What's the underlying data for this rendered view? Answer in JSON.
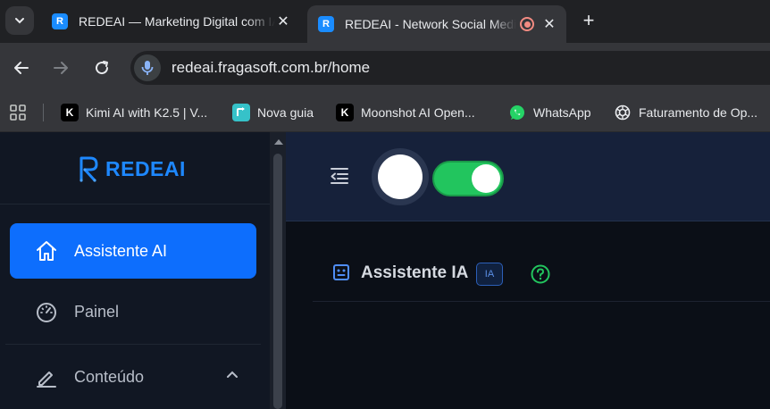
{
  "tabs": [
    {
      "title": "REDEAI — Marketing Digital com IA",
      "favicon": "R",
      "active": false
    },
    {
      "title": "REDEAI - Network Social Media",
      "favicon": "R",
      "active": true
    }
  ],
  "address": {
    "url": "redeai.fragasoft.com.br/home"
  },
  "bookmarks": [
    {
      "label": "Kimi AI with K2.5 | V...",
      "icon": "K"
    },
    {
      "label": "Nova guia",
      "icon": ""
    },
    {
      "label": "Moonshot AI Open...",
      "icon": "K"
    },
    {
      "label": "WhatsApp",
      "icon": ""
    },
    {
      "label": "Faturamento de Op...",
      "icon": ""
    }
  ],
  "sidebar": {
    "logo_text": "REDEAI",
    "items": [
      {
        "label": "Assistente AI",
        "icon": "home-icon",
        "active": true
      },
      {
        "label": "Painel",
        "icon": "dashboard-gauge-icon",
        "active": false
      },
      {
        "label": "Conteúdo",
        "icon": "pencil-icon",
        "active": false
      }
    ]
  },
  "topbar": {
    "theme_toggle_on": true
  },
  "content": {
    "title": "Assistente IA",
    "badge": "IA"
  },
  "colors": {
    "accent": "#0d6efd",
    "toggle": "#22c55e",
    "logo": "#1e88ff",
    "help": "#22c55e"
  }
}
